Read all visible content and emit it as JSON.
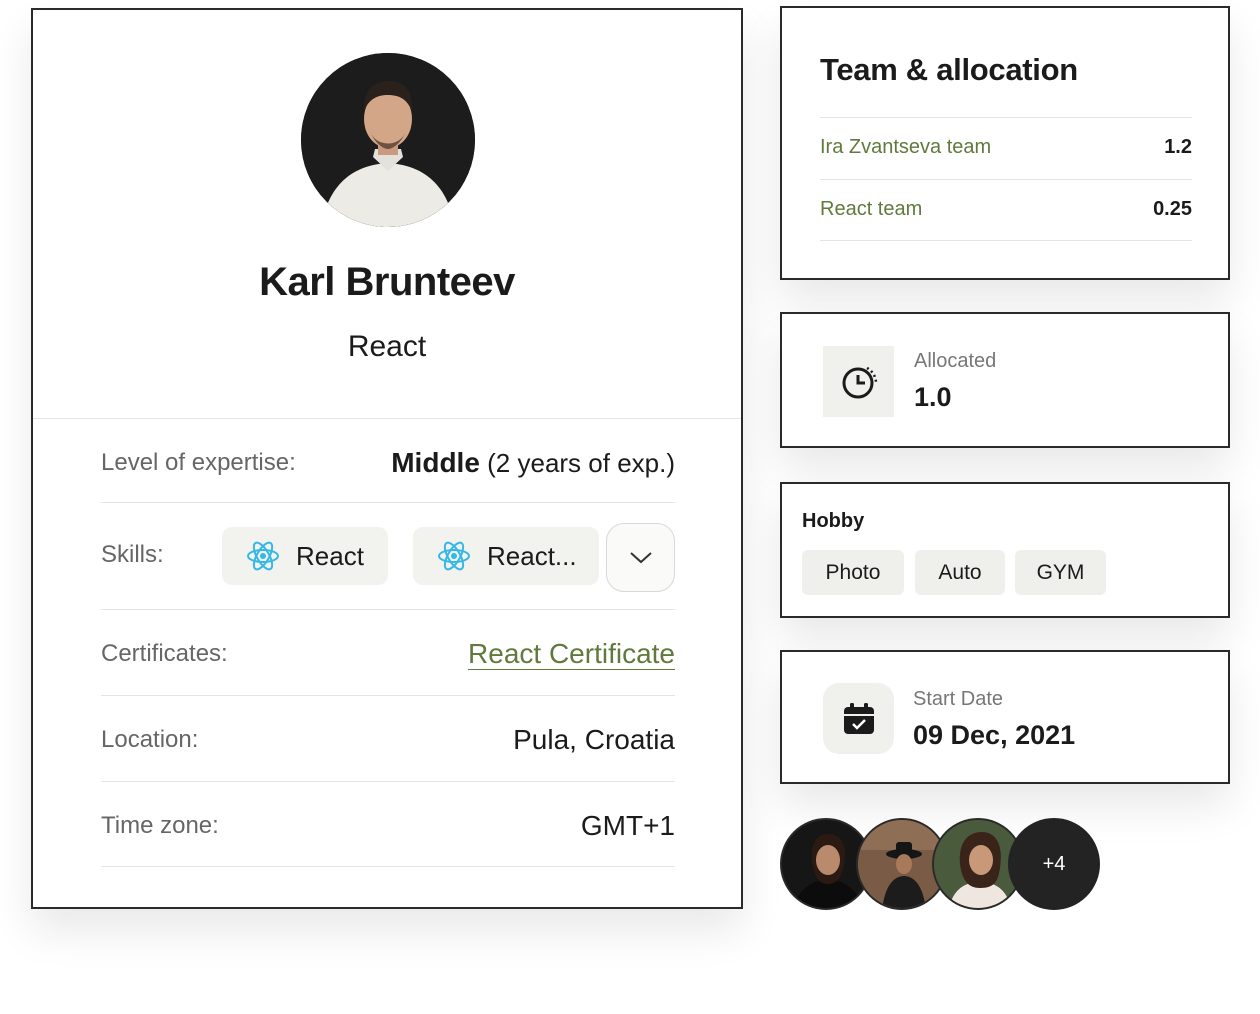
{
  "profile": {
    "name": "Karl Brunteev",
    "role": "React",
    "expertise_label": "Level of expertise:",
    "expertise_level": "Middle",
    "expertise_years": "(2 years of exp.)",
    "skills_label": "Skills:",
    "skills": [
      "React",
      "React..."
    ],
    "certificates_label": "Certificates:",
    "certificate": "React Certificate",
    "location_label": "Location:",
    "location": "Pula, Croatia",
    "timezone_label": "Time zone:",
    "timezone": "GMT+1"
  },
  "team": {
    "title": "Team & allocation",
    "rows": [
      {
        "name": "Ira Zvantseva team",
        "value": "1.2"
      },
      {
        "name": "React team",
        "value": "0.25"
      }
    ]
  },
  "allocated": {
    "label": "Allocated",
    "value": "1.0"
  },
  "hobby": {
    "title": "Hobby",
    "items": [
      "Photo",
      "Auto",
      "GYM"
    ]
  },
  "start_date": {
    "label": "Start Date",
    "value": "09 Dec, 2021"
  },
  "avatars": {
    "more": "+4"
  },
  "colors": {
    "accent_green": "#5f7a3c",
    "chip_bg": "#f2f2ee",
    "react_blue": "#35b8e6"
  }
}
